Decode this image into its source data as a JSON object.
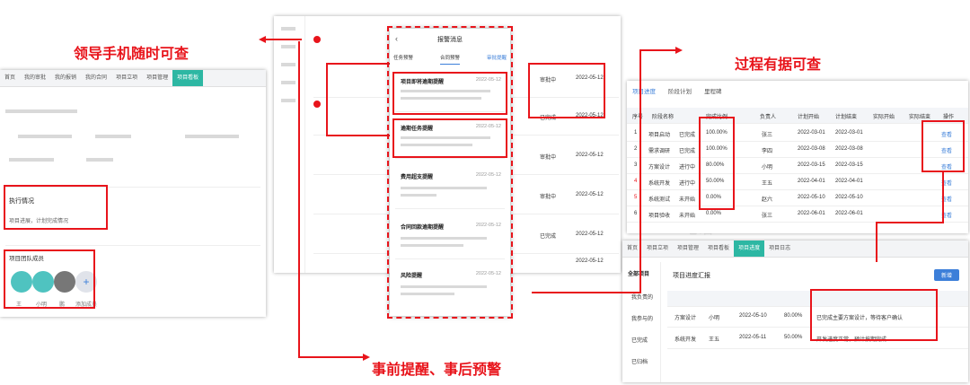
{
  "captions": {
    "leader": "领导手机随时可查",
    "process": "过程有据可查",
    "warning": "事前提醒、事后预警"
  },
  "watermark": {
    "phone": "电话: 400-665-0028",
    "web": "网址: www.chanjet.net"
  },
  "colors": {
    "accent_red": "#e8141b",
    "teal": "#2db7a3",
    "blue": "#3c7fd9"
  },
  "left_panel": {
    "tabs": [
      "首页",
      "我的审批",
      "我的报销",
      "我的合同",
      "项目立项",
      "项目管理",
      "项目看板"
    ],
    "progress_block": {
      "title": "执行情况",
      "text": "项目进展，计划完成情况"
    },
    "members_title": "项目团队成员",
    "members": [
      {
        "name": "王",
        "color": "#4fc3c0"
      },
      {
        "name": "小明",
        "color": "#4fc3c0"
      },
      {
        "name": "鹏",
        "color": "#777777"
      },
      {
        "name": "添加成员",
        "color": "#e0e3ea"
      }
    ]
  },
  "mid_panel": {
    "header": "报警消息",
    "tabs": [
      "任务预警",
      "合同预警",
      "审批提醒"
    ],
    "messages": [
      {
        "title": "项目即将逾期提醒",
        "time": "2022-05-12"
      },
      {
        "title": "逾期任务提醒",
        "time": "2022-05-12"
      },
      {
        "title": "费用超支提醒",
        "time": "2022-05-12"
      },
      {
        "title": "合同回款逾期提醒",
        "time": "2022-05-12"
      },
      {
        "title": "风险提醒",
        "time": "2022-05-12"
      }
    ],
    "list_dates": [
      "2022-05-12",
      "2022-05-12",
      "2022-05-12",
      "2022-05-12",
      "2022-05-12",
      "2022-05-12"
    ],
    "list_status": [
      "审批中",
      "已完成",
      "审批中",
      "审批中",
      "已完成",
      "审批中"
    ]
  },
  "right_top_panel": {
    "tabs": [
      "项目进度",
      "阶段计划",
      "里程碑"
    ],
    "headers": [
      "序号",
      "阶段名称",
      "完成比例",
      "负责人",
      "计划开始",
      "计划结束",
      "实际开始",
      "实际结束",
      "操作"
    ],
    "rows": [
      {
        "no": "1",
        "name": "项目启动",
        "status": "已完成",
        "pct": "100.00%",
        "owner": "张三",
        "date": "2022-03-01",
        "action": "查看"
      },
      {
        "no": "2",
        "name": "需求调研",
        "status": "已完成",
        "pct": "100.00%",
        "owner": "李四",
        "date": "2022-03-08",
        "action": "查看"
      },
      {
        "no": "3",
        "name": "方案设计",
        "status": "进行中",
        "pct": "80.00%",
        "owner": "小明",
        "date": "2022-03-15",
        "action": "查看"
      },
      {
        "no": "4",
        "name": "系统开发",
        "status": "进行中",
        "pct": "50.00%",
        "owner": "王五",
        "date": "2022-04-01",
        "action": "查看"
      },
      {
        "no": "5",
        "name": "系统测试",
        "status": "未开始",
        "pct": "0.00%",
        "owner": "赵六",
        "date": "2022-05-10",
        "action": "查看"
      },
      {
        "no": "6",
        "name": "项目验收",
        "status": "未开始",
        "pct": "0.00%",
        "owner": "张三",
        "date": "2022-06-01",
        "action": "查看"
      }
    ]
  },
  "right_bottom_panel": {
    "tabs": [
      "首页",
      "项目立项",
      "项目管理",
      "项目看板",
      "项目进度",
      "项目日志"
    ],
    "sidebar": [
      "全部项目",
      "我负责的",
      "我参与的",
      "已完成",
      "已归档"
    ],
    "title": "项目进度汇报",
    "new_button": "新增",
    "rows": [
      {
        "name": "方案设计",
        "owner": "小明",
        "date": "2022-05-10",
        "pct": "80.00%",
        "note": "已完成主要方案设计，等待客户确认"
      },
      {
        "name": "系统开发",
        "owner": "王五",
        "date": "2022-05-11",
        "pct": "50.00%",
        "note": "开发进度正常，预计按期完成"
      }
    ]
  }
}
